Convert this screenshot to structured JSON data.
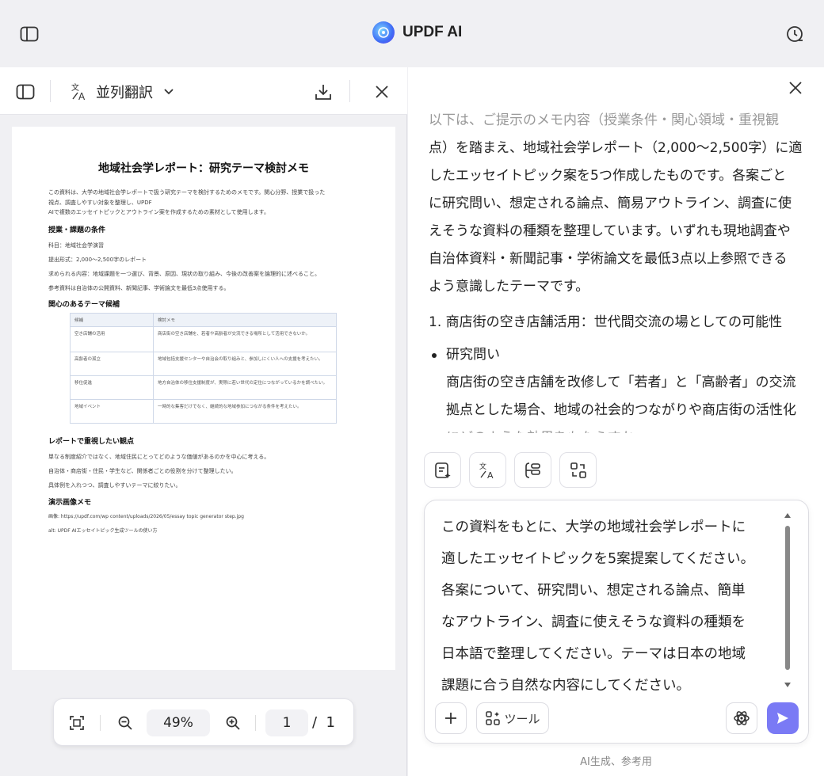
{
  "app": {
    "title": "UPDF AI"
  },
  "left_toolbar": {
    "mode_label": "並列翻訳"
  },
  "pdf": {
    "title": "地域社会学レポート：研究テーマ検討メモ",
    "intro": [
      "この資料は、大学の地域社会学レポートで扱う研究テーマを検討するためのメモです。関心分野、授業で扱った",
      "視点、調査しやすい対象を整理し、UPDF",
      "AIで複数のエッセイトピックとアウトライン案を作成するための素材として使用します。"
    ],
    "section1_heading": "授業・課題の条件",
    "section1_items": [
      "科目：地域社会学演習",
      "提出形式：2,000〜2,500字のレポート",
      "求められる内容：地域課題を一つ選び、背景、原因、現状の取り組み、今後の改善案を論理的に述べること。",
      "参考資料は自治体の公開資料、新聞記事、学術論文を最低3点使用する。"
    ],
    "section2_heading": "関心のあるテーマ候補",
    "table": {
      "headers": [
        "候補",
        "検討メモ"
      ],
      "rows": [
        [
          "空き店舗の活用",
          "商店街の空き店舗を、若者や高齢者が交流できる場所として活用できないか。"
        ],
        [
          "高齢者の孤立",
          "地域包括支援センターや自治会の取り組みと、参加しにくい人への支援を考えたい。"
        ],
        [
          "移住促進",
          "地方自治体の移住支援制度が、実際に若い世代の定住につながっているかを調べたい。"
        ],
        [
          "地域イベント",
          "一時的な集客だけでなく、継続的な地域参加につながる条件を考えたい。"
        ]
      ]
    },
    "section3_heading": "レポートで重視したい観点",
    "section3_items": [
      "単なる制度紹介ではなく、地域住民にとってどのような価値があるのかを中心に考える。",
      "自治体・商店街・住民・学生など、関係者ごとの役割を分けて整理したい。",
      "具体例を入れつつ、調査しやすいテーマに絞りたい。"
    ],
    "section4_heading": "演示画像メモ",
    "section4_items": [
      "画像: https://updf.com/wp content/uploads/2026/05/essay topic generator step.jpg",
      "alt: UPDF AIエッセイトピック生成ツールの使い方"
    ]
  },
  "zoom_bar": {
    "zoom": "49%",
    "page": "1",
    "page_sep": "/",
    "total": "1"
  },
  "chat": {
    "lines": [
      "以下は、ご提示のメモ内容（授業条件・関心領域・重視観",
      "点）を踏まえ、地域社会学レポート（2,000～2,500字）に適",
      "したエッセイトピック案を5つ作成したものです。各案ごと",
      "に研究問い、想定される論点、簡易アウトライン、調査に使",
      "えそうな資料の種類を整理しています。いずれも現地調査や",
      "自治体資料・新聞記事・学術論文を最低3点以上参照できる",
      "よう意識したテーマです。"
    ],
    "item1": "1. 商店街の空き店舗活用：世代間交流の場としての可能性",
    "bullet_title": "研究問い",
    "bullet_lines": [
      "商店街の空き店舗を改修して「若者」と「高齢者」の交流",
      "拠点とした場合、地域の社会的つながりや商店街の活性化",
      "にどのような効果をもたらすか"
    ]
  },
  "composer": {
    "prompt_lines": [
      "この資料をもとに、大学の地域社会学レポートに",
      "適したエッセイトピックを5案提案してください。",
      "各案について、研究問い、想定される論点、簡単",
      "なアウトライン、調査に使えそうな資料の種類を",
      "日本語で整理してください。テーマは日本の地域",
      "課題に合う自然な内容にしてください。"
    ],
    "tools_label": "ツール"
  },
  "footer": {
    "note": "AI生成、参考用"
  }
}
